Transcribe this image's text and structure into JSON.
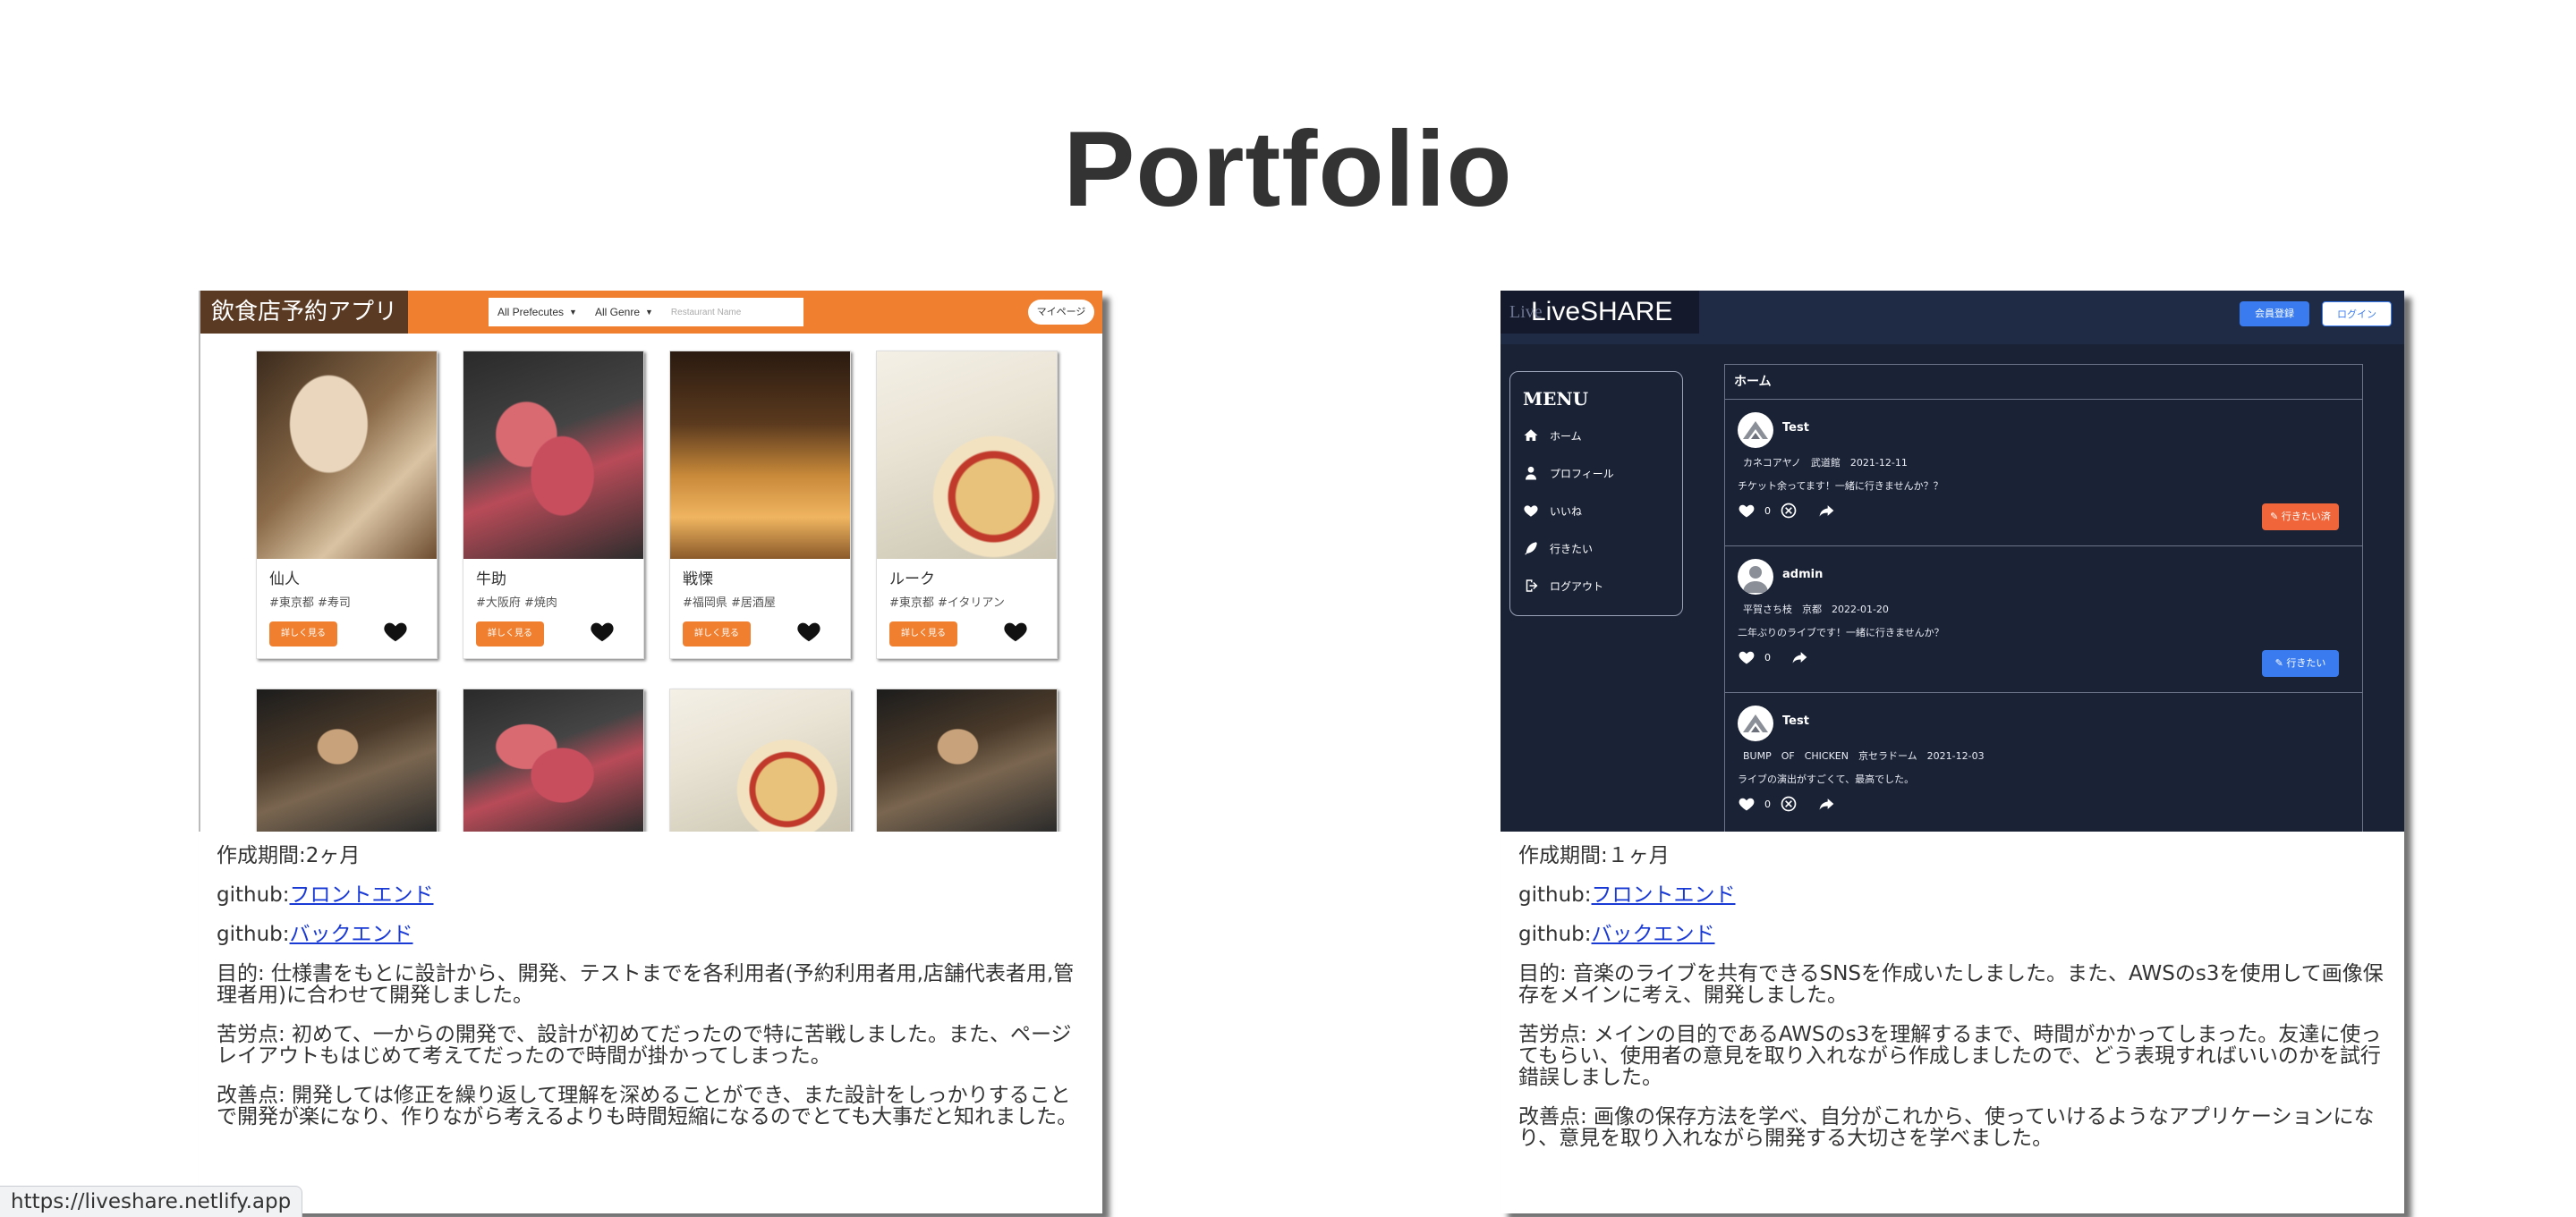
{
  "page": {
    "title": "Portfolio"
  },
  "restaurant": {
    "app_name": "飲食店予約アプリ",
    "search": {
      "prefecture": "All Prefecutes",
      "genre": "All Genre",
      "placeholder": "Restaurant Name"
    },
    "mypage_label": "マイページ",
    "detail_label": "詳しく見る",
    "shops": [
      {
        "name": "仙人",
        "tags": "#東京都 #寿司",
        "photo": "sushi"
      },
      {
        "name": "牛助",
        "tags": "#大阪府 #焼肉",
        "photo": "beef"
      },
      {
        "name": "戦慄",
        "tags": "#福岡県 #居酒屋",
        "photo": "izakaya"
      },
      {
        "name": "ルーク",
        "tags": "#東京都 #イタリアン",
        "photo": "pizza"
      }
    ],
    "period": "作成期間:2ヶ月",
    "github_prefix": "github:",
    "frontend_link": "フロントエンド",
    "backend_link": "バックエンド",
    "purpose": "目的: 仕様書をもとに設計から、開発、テストまでを各利用者(予約利用者用,店舗代表者用,管理者用)に合わせて開発しました。",
    "difficulty": "苦労点: 初めて、一からの開発で、設計が初めてだったので特に苦戦しました。また、ページレイアウトもはじめて考えてだったので時間が掛かってしまった。",
    "improvement": "改善点: 開発しては修正を繰り返して理解を深めることができ、また設計をしっかりすることで開発が楽になり、作りながら考えるよりも時間短縮になるのでとても大事だと知れました。"
  },
  "liveshare": {
    "logo": "LiveSHARE",
    "logo_ghost": "Live",
    "register_label": "会員登録",
    "login_label": "ログイン",
    "menu_title": "MENU",
    "menu_items": [
      "ホーム",
      "プロフィール",
      "いいね",
      "行きたい",
      "ログアウト"
    ],
    "feed_title": "ホーム",
    "posts": [
      {
        "user": "Test",
        "meta": "カネコアヤノ　武道館　2021-12-11",
        "text": "チケット余ってます！一緒に行きませんか？？",
        "likes": "0",
        "button": "行きたい済"
      },
      {
        "user": "admin",
        "meta": "平賀さち枝　京都　2022-01-20",
        "text": "二年ぶりのライブです！一緒に行きませんか？",
        "likes": "0",
        "button": "行きたい"
      },
      {
        "user": "Test",
        "meta": "BUMP　OF　CHICKEN　京セラドーム　2021-12-03",
        "text": "ライブの演出がすごくて、最高でした。",
        "likes": "0"
      }
    ],
    "period": "作成期間:１ヶ月",
    "github_prefix": "github:",
    "frontend_link": "フロントエンド",
    "backend_link": "バックエンド",
    "purpose": "目的: 音楽のライブを共有できるSNSを作成いたしました。また、AWSのs3を使用して画像保存をメインに考え、開発しました。",
    "difficulty": "苦労点: メインの目的であるAWSのs3を理解するまで、時間がかかってしまった。友達に使ってもらい、使用者の意見を取り入れながら作成しましたので、どう表現すればいいのかを試行錯誤しました。",
    "improvement": "改善点: 画像の保存方法を学べ、自分がこれから、使っていけるようなアプリケーションになり、意見を取り入れながら開発する大切さを学べました。"
  },
  "status_bar": {
    "url": "https://liveshare.netlify.app"
  },
  "colors": {
    "restaurant_accent": "#f08030",
    "liveshare_bg": "#1a2236",
    "link": "#1a3ad6"
  }
}
